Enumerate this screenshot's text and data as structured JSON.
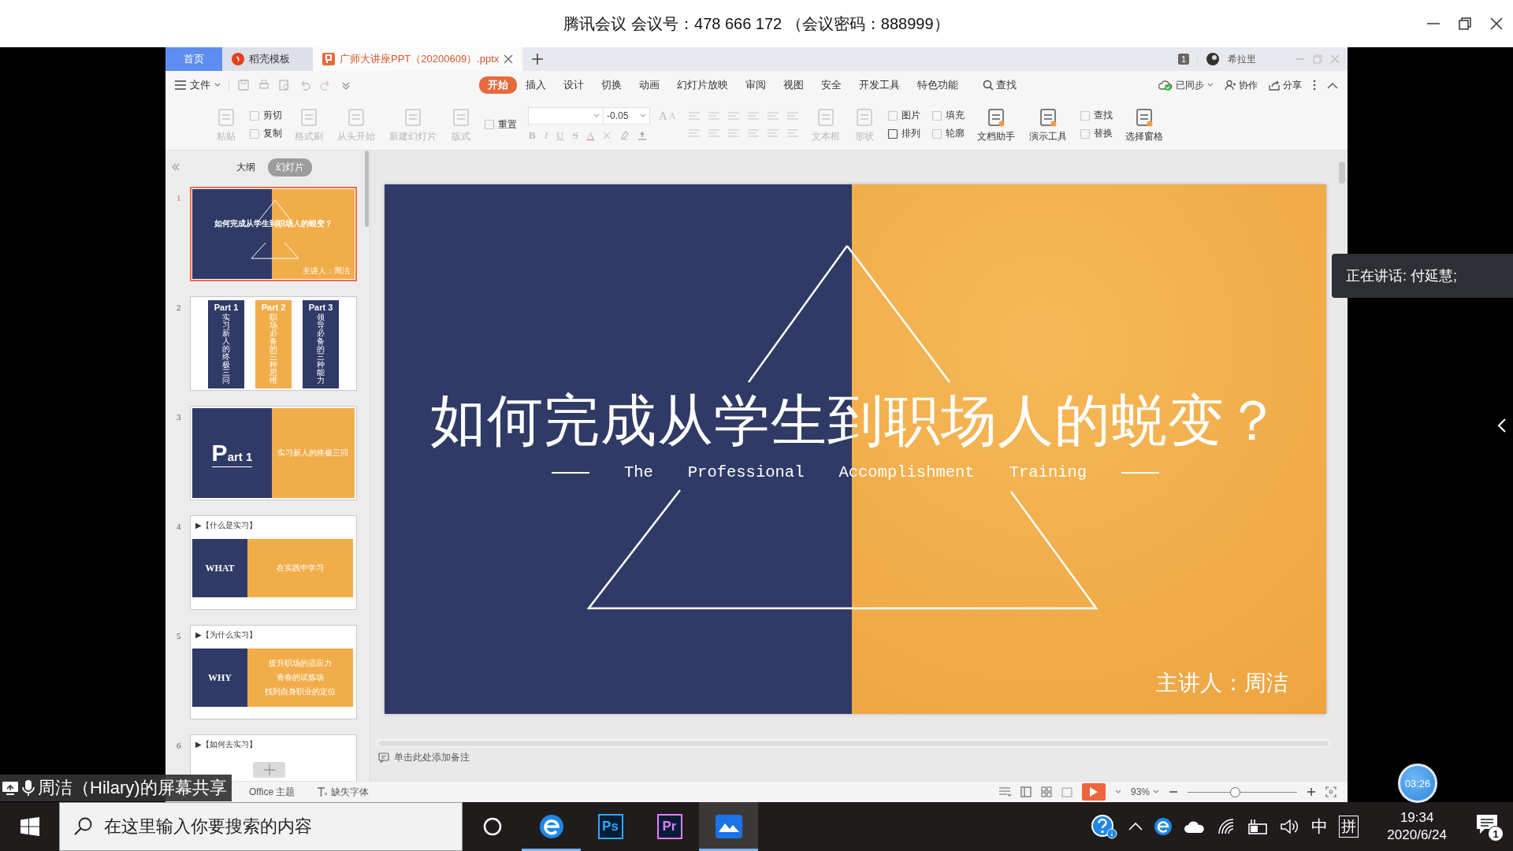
{
  "meeting_bar": {
    "title": "腾讯会议 会议号：478 666 172 （会议密码：888999）"
  },
  "wps": {
    "doc_tabs": [
      {
        "kind": "home",
        "label": "首页",
        "selected": false
      },
      {
        "kind": "template",
        "label": "稻壳模板",
        "selected": false
      },
      {
        "kind": "document",
        "label": "广师大讲座PPT（20200609）.pptx",
        "selected": true
      }
    ],
    "account": {
      "badge": "1",
      "name": "希拉里"
    },
    "file_menu": "文件",
    "menu_tabs": [
      {
        "label": "开始",
        "selected": true
      },
      {
        "label": "插入",
        "selected": false
      },
      {
        "label": "设计",
        "selected": false
      },
      {
        "label": "切换",
        "selected": false
      },
      {
        "label": "动画",
        "selected": false
      },
      {
        "label": "幻灯片放映",
        "selected": false
      },
      {
        "label": "审阅",
        "selected": false
      },
      {
        "label": "视图",
        "selected": false
      },
      {
        "label": "安全",
        "selected": false
      },
      {
        "label": "开发工具",
        "selected": false
      },
      {
        "label": "特色功能",
        "selected": false
      }
    ],
    "search": "查找",
    "sync": "已同步",
    "collab": "协作",
    "share": "分享",
    "ribbon": [
      {
        "kind": "large",
        "label": "粘贴",
        "disabled": true
      },
      {
        "kind": "stack",
        "items": [
          {
            "label": "剪切",
            "disabled": true
          },
          {
            "label": "复制",
            "disabled": true
          }
        ]
      },
      {
        "kind": "large",
        "label": "格式刷",
        "disabled": true
      },
      {
        "kind": "large",
        "label": "从头开始",
        "disabled": true
      },
      {
        "kind": "large",
        "label": "新建幻灯片",
        "disabled": true
      },
      {
        "kind": "large",
        "label": "版式",
        "disabled": true
      },
      {
        "kind": "stack",
        "items": [
          {
            "label": "重置",
            "disabled": true
          }
        ]
      },
      {
        "kind": "font",
        "size": "-0.05",
        "size_buttons": [
          "A",
          "A"
        ],
        "style_buttons": [
          "B",
          "I",
          "U",
          "S",
          "A"
        ]
      },
      {
        "kind": "paragraph"
      },
      {
        "kind": "large",
        "label": "文本框",
        "disabled": true
      },
      {
        "kind": "large",
        "label": "形状",
        "disabled": true
      },
      {
        "kind": "stack",
        "items": [
          {
            "label": "图片",
            "disabled": true
          },
          {
            "label": "排列",
            "disabled": false
          }
        ]
      },
      {
        "kind": "stack",
        "items": [
          {
            "label": "填充",
            "disabled": true
          },
          {
            "label": "轮廓",
            "disabled": true
          }
        ]
      },
      {
        "kind": "large",
        "label": "文档助手",
        "disabled": false
      },
      {
        "kind": "large",
        "label": "演示工具",
        "disabled": false
      },
      {
        "kind": "stack",
        "items": [
          {
            "label": "查找",
            "disabled": true
          },
          {
            "label": "替换",
            "disabled": true
          }
        ]
      },
      {
        "kind": "large",
        "label": "选择窗格",
        "disabled": false
      }
    ],
    "panel_tabs": [
      {
        "label": "大纲",
        "selected": false
      },
      {
        "label": "幻灯片",
        "selected": true
      }
    ],
    "slides": [
      {
        "number": "1",
        "selected": true,
        "kind": "title",
        "title": "如何完成从学生到职场人的蜕变？",
        "speaker": "主讲人：周洁"
      },
      {
        "number": "2",
        "selected": false,
        "kind": "parts",
        "parts": [
          {
            "label": "Part 1",
            "text": "实习新人的终极三问",
            "color": "#2f3a66"
          },
          {
            "label": "Part 2",
            "text": "职场必备的三种思维",
            "color": "#f2ad4b"
          },
          {
            "label": "Part 3",
            "text": "领导必备的三种能力",
            "color": "#2f3a66"
          }
        ]
      },
      {
        "number": "3",
        "selected": false,
        "kind": "section",
        "label": "Part 1",
        "text": "实习新人的终极三问"
      },
      {
        "number": "4",
        "selected": false,
        "kind": "topic",
        "header": "▶【什么是实习】",
        "label": "WHAT",
        "lines": [
          "在实践中学习"
        ]
      },
      {
        "number": "5",
        "selected": false,
        "kind": "topic",
        "header": "▶【为什么实习】",
        "label": "WHY",
        "lines": [
          "提升职场的适应力",
          "青春的试炼场",
          "找到自身职业的定位"
        ]
      },
      {
        "number": "6",
        "selected": false,
        "kind": "topic",
        "header": "▶【如何去实习】"
      }
    ],
    "stage": {
      "title": "如何完成从学生到职场人的蜕变？",
      "subtitle": [
        "The",
        "Professional",
        "Accomplishment",
        "Training"
      ],
      "speaker": "主讲人：周洁"
    },
    "notes": {
      "placeholder": "单击此处添加备注"
    },
    "status": {
      "theme": "Office 主题",
      "missing_fonts": "缺失字体",
      "zoom": "93%",
      "zoom_slider": {
        "level": 0.43
      }
    }
  },
  "meeting": {
    "speaking": "正在讲话: 付延慧;",
    "share_label": "周洁（Hilary)的屏幕共享",
    "timer": "03:26"
  },
  "taskbar": {
    "search": {
      "placeholder": "在这里输入你要搜索的内容"
    },
    "apps": [
      {
        "kind": "ring",
        "running": false,
        "selected": false
      },
      {
        "kind": "browser",
        "running": true,
        "selected": false
      },
      {
        "kind": "text",
        "label": "Ps",
        "color": "#31a8ff",
        "running": false,
        "selected": false
      },
      {
        "kind": "text",
        "label": "Pr",
        "color": "#e77cff",
        "running": false,
        "selected": false
      },
      {
        "kind": "meeting",
        "running": true,
        "selected": true
      }
    ],
    "input_mode": "中",
    "ime": "拼",
    "time": "19:34",
    "date": "2020/6/24",
    "notifications": "1"
  }
}
